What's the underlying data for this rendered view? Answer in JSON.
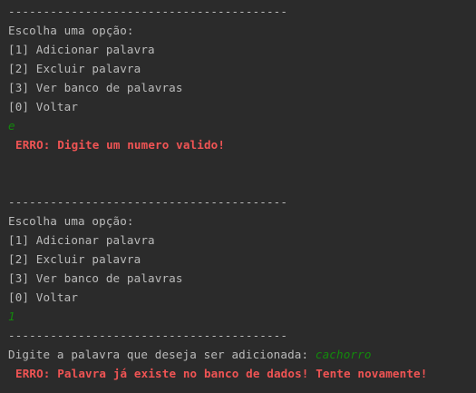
{
  "colors": {
    "background": "#2b2b2b",
    "output_text": "#bbbbbb",
    "user_input": "#13890c",
    "error_text": "#f05454"
  },
  "console": {
    "block1": {
      "separator": "----------------------------------------",
      "prompt": "Escolha uma opção:",
      "options": [
        "[1] Adicionar palavra",
        "[2] Excluir palavra",
        "[3] Ver banco de palavras",
        "[0] Voltar"
      ],
      "user_input": "e",
      "error": "ERRO: Digite um numero valido!"
    },
    "block2": {
      "separator": "----------------------------------------",
      "prompt": "Escolha uma opção:",
      "options": [
        "[1] Adicionar palavra",
        "[2] Excluir palavra",
        "[3] Ver banco de palavras",
        "[0] Voltar"
      ],
      "user_input": "1"
    },
    "block3": {
      "separator": "----------------------------------------",
      "word_prompt": "Digite a palavra que deseja ser adicionada: ",
      "word_input": "cachorro",
      "error": "ERRO: Palavra já existe no banco de dados! Tente novamente!"
    }
  }
}
